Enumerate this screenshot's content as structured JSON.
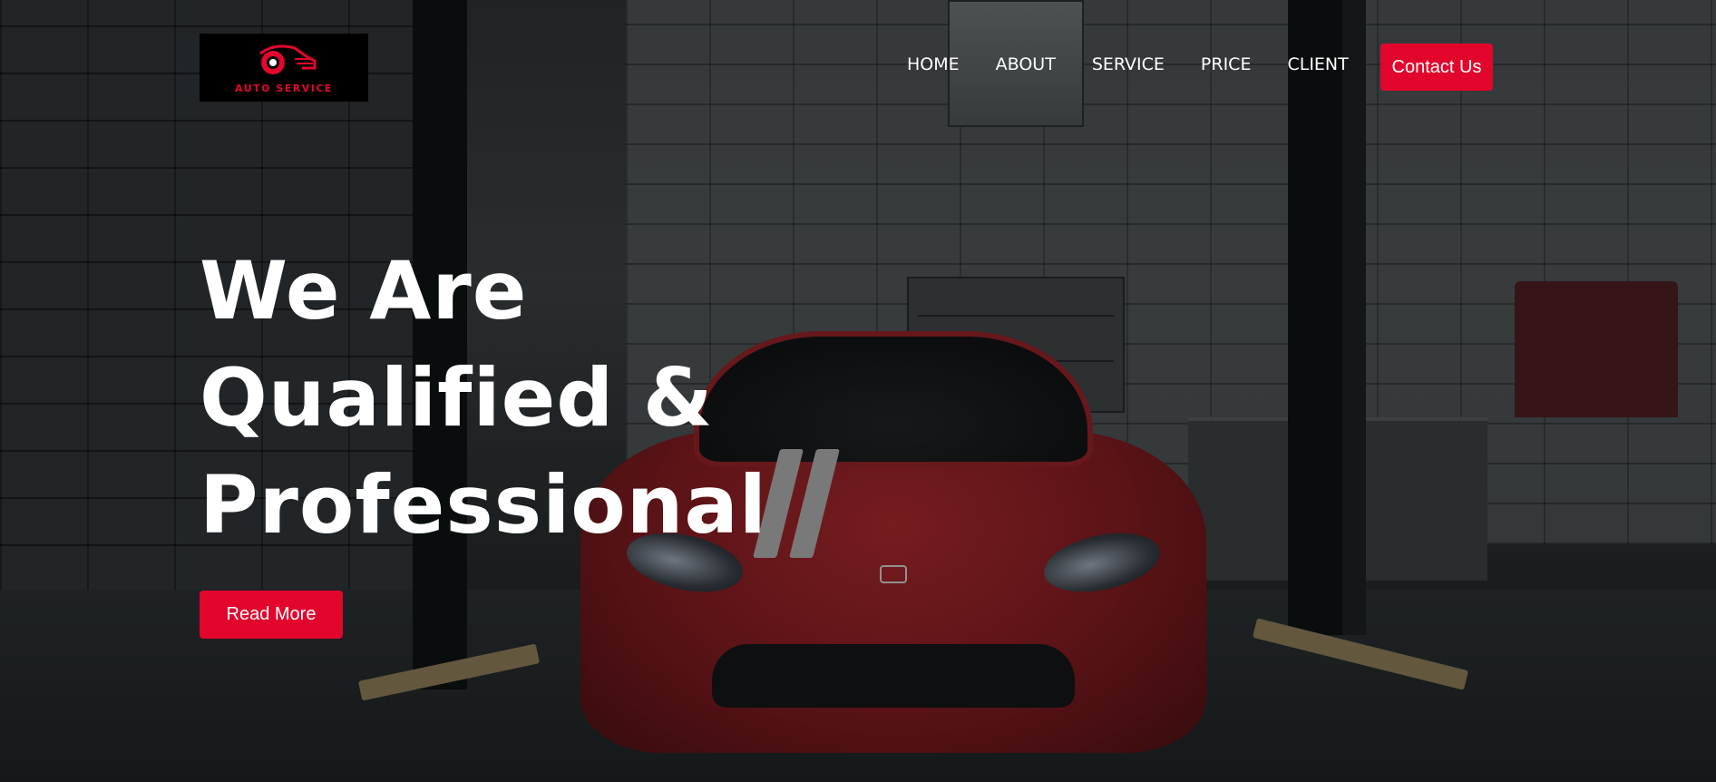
{
  "header": {
    "logo_text": "AUTO SERVICE",
    "nav": [
      {
        "label": "HOME"
      },
      {
        "label": "ABOUT"
      },
      {
        "label": "SERVICE"
      },
      {
        "label": "PRICE"
      },
      {
        "label": "CLIENT"
      }
    ],
    "contact_label": "Contact Us"
  },
  "hero": {
    "title_lines": [
      "We Are",
      "Qualified &",
      "Professional"
    ],
    "read_more_label": "Read More"
  },
  "colors": {
    "accent": "#e3062c",
    "text": "#ffffff",
    "logo_bg": "#000000"
  },
  "icons": {
    "logo": "car-logo-icon"
  }
}
